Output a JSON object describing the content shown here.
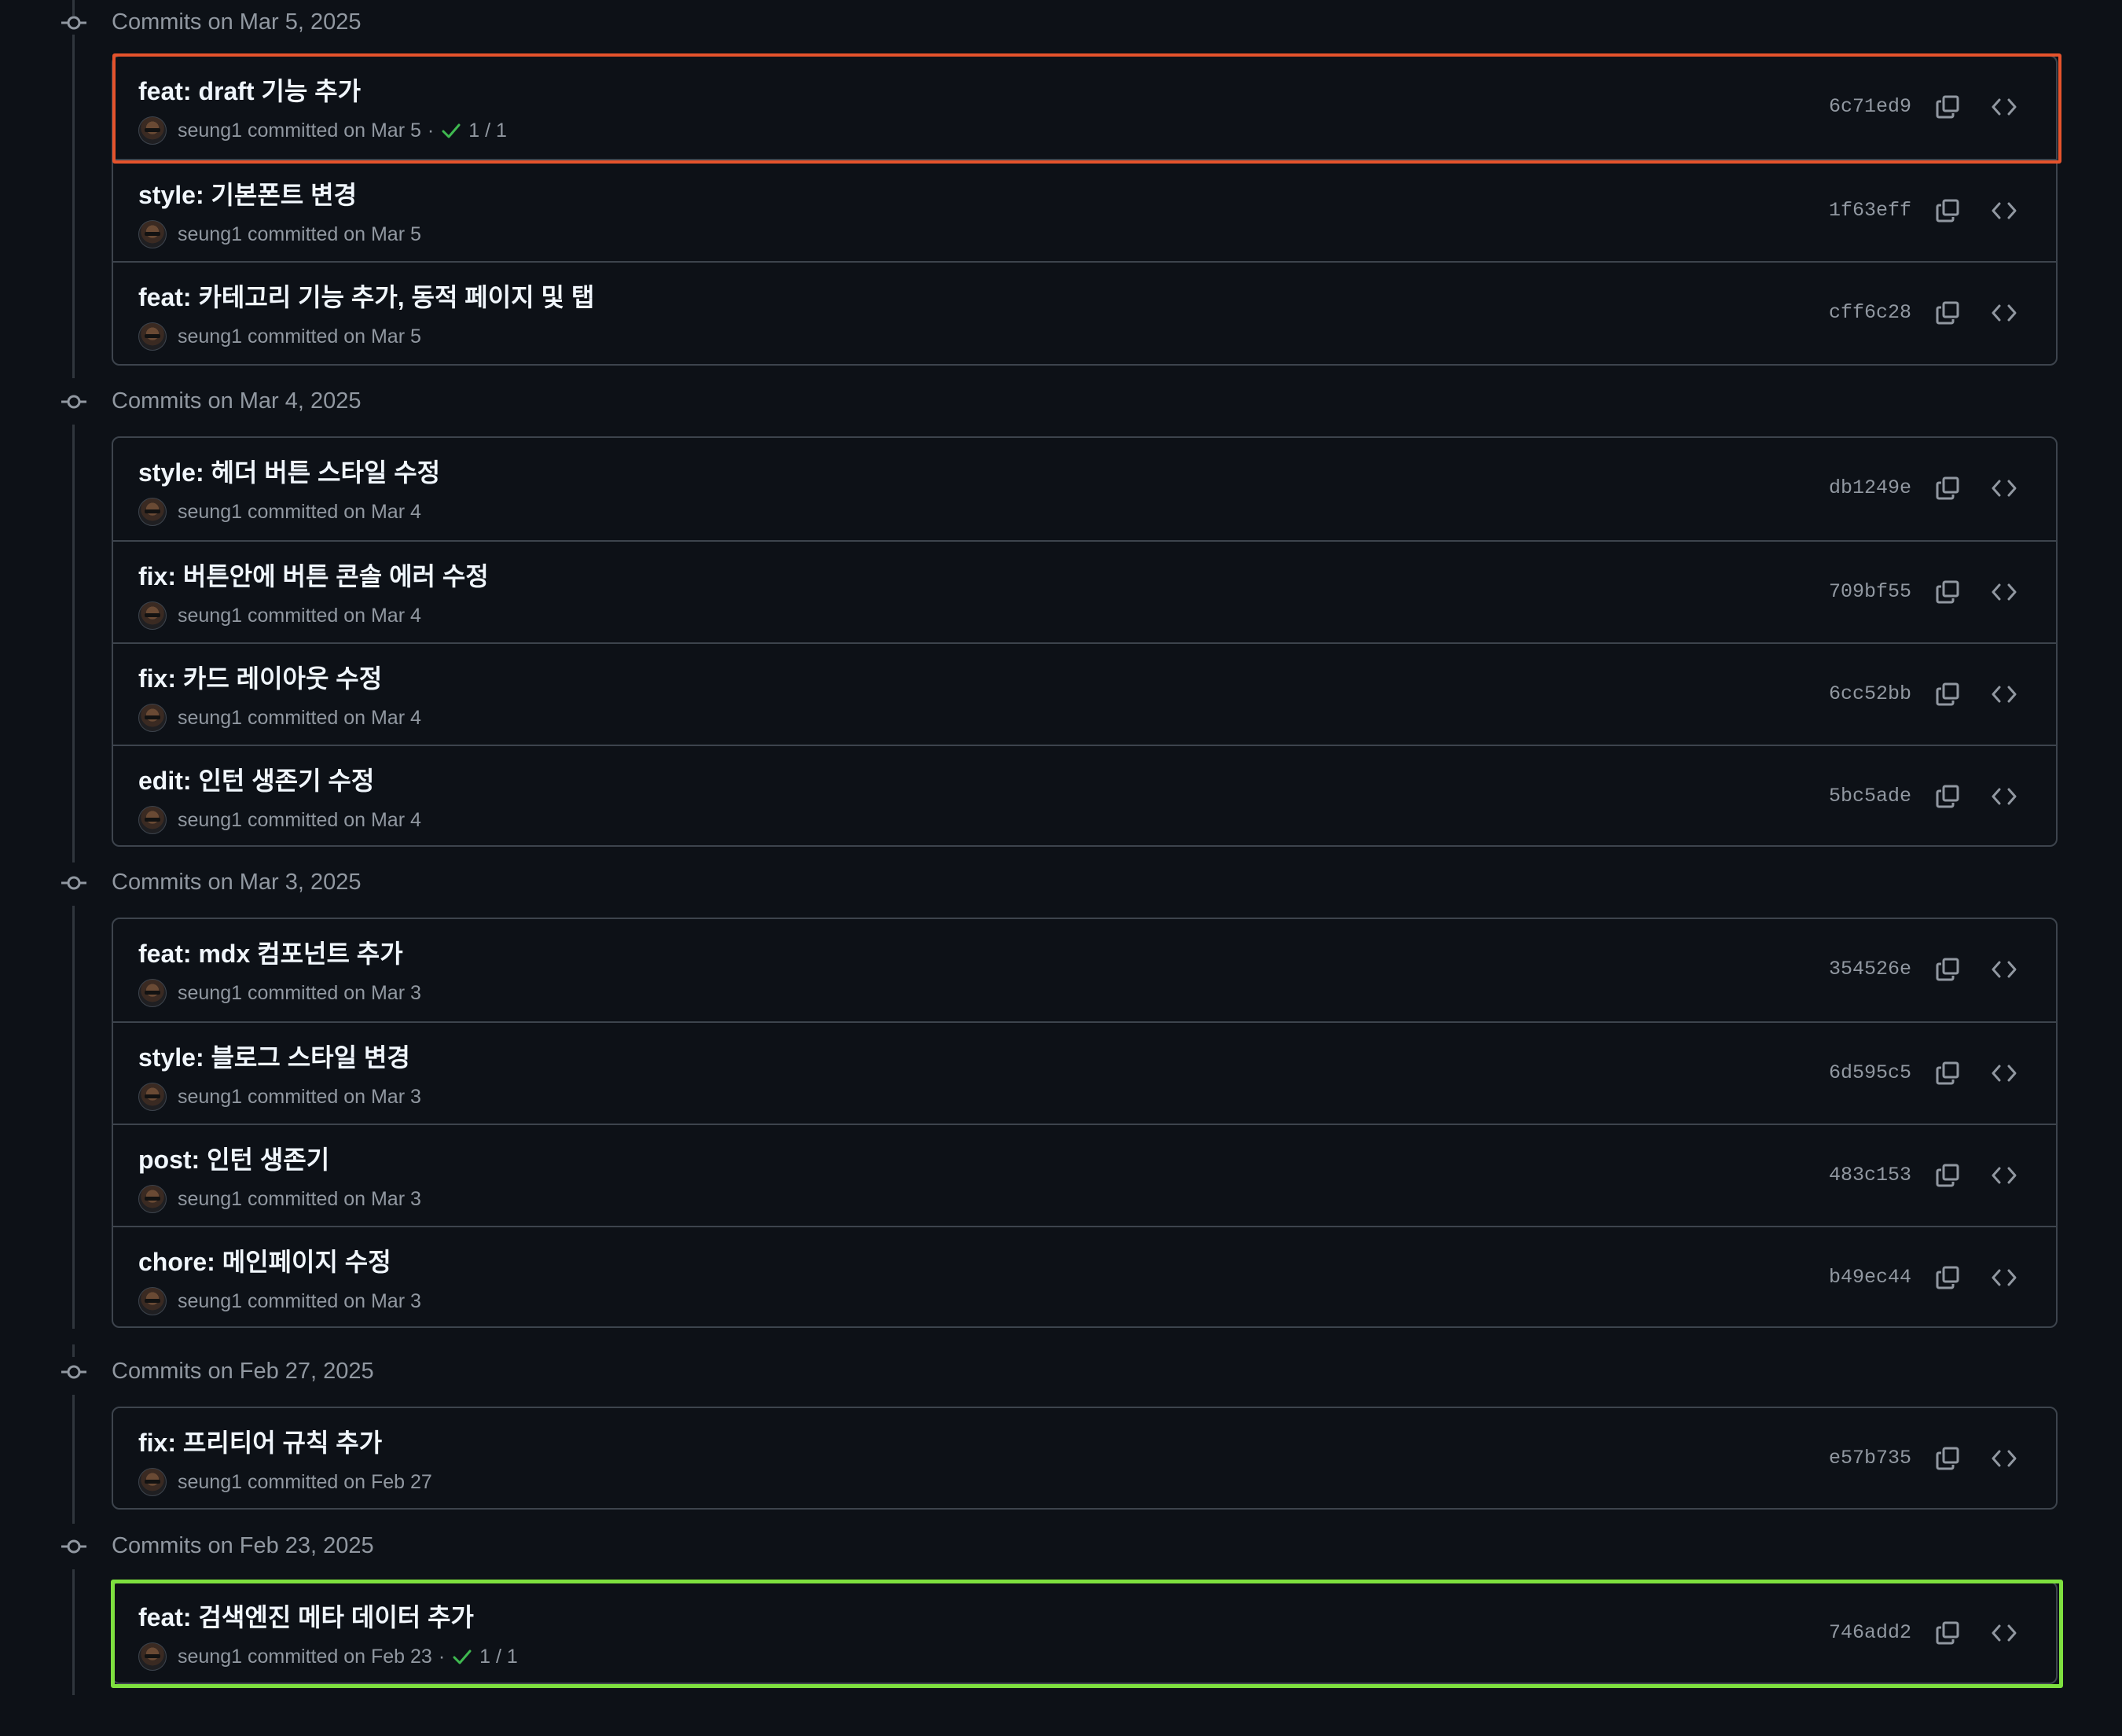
{
  "groups": [
    {
      "title": "Commits on Mar 5, 2025",
      "commits": [
        {
          "message": "feat: draft 기능 추가",
          "meta": "seung1 committed on Mar 5",
          "checks": "1 / 1",
          "sha": "6c71ed9"
        },
        {
          "message": "style: 기본폰트 변경",
          "meta": "seung1 committed on Mar 5",
          "checks": "",
          "sha": "1f63eff"
        },
        {
          "message": "feat: 카테고리 기능 추가, 동적 페이지 및 탭",
          "meta": "seung1 committed on Mar 5",
          "checks": "",
          "sha": "cff6c28"
        }
      ]
    },
    {
      "title": "Commits on Mar 4, 2025",
      "commits": [
        {
          "message": "style: 헤더 버튼 스타일 수정",
          "meta": "seung1 committed on Mar 4",
          "checks": "",
          "sha": "db1249e"
        },
        {
          "message": "fix: 버튼안에 버튼 콘솔 에러 수정",
          "meta": "seung1 committed on Mar 4",
          "checks": "",
          "sha": "709bf55"
        },
        {
          "message": "fix: 카드 레이아웃 수정",
          "meta": "seung1 committed on Mar 4",
          "checks": "",
          "sha": "6cc52bb"
        },
        {
          "message": "edit: 인턴 생존기 수정",
          "meta": "seung1 committed on Mar 4",
          "checks": "",
          "sha": "5bc5ade"
        }
      ]
    },
    {
      "title": "Commits on Mar 3, 2025",
      "commits": [
        {
          "message": "feat: mdx 컴포넌트 추가",
          "meta": "seung1 committed on Mar 3",
          "checks": "",
          "sha": "354526e"
        },
        {
          "message": "style: 블로그 스타일 변경",
          "meta": "seung1 committed on Mar 3",
          "checks": "",
          "sha": "6d595c5"
        },
        {
          "message": "post: 인턴 생존기",
          "meta": "seung1 committed on Mar 3",
          "checks": "",
          "sha": "483c153"
        },
        {
          "message": "chore: 메인페이지 수정",
          "meta": "seung1 committed on Mar 3",
          "checks": "",
          "sha": "b49ec44"
        }
      ]
    },
    {
      "title": "Commits on Feb 27, 2025",
      "commits": [
        {
          "message": "fix: 프리티어 규칙 추가",
          "meta": "seung1 committed on Feb 27",
          "checks": "",
          "sha": "e57b735"
        }
      ]
    },
    {
      "title": "Commits on Feb 23, 2025",
      "commits": [
        {
          "message": "feat: 검색엔진 메타 데이터 추가",
          "meta": "seung1 committed on Feb 23",
          "checks": "1 / 1",
          "sha": "746add2"
        }
      ]
    }
  ],
  "icons": {
    "group": "git-commit-icon",
    "copy": "copy-icon",
    "browse": "code-icon",
    "check": "check-icon"
  },
  "colors": {
    "background": "#0d1117",
    "border": "#3d444d",
    "muted_text": "#9198a1",
    "title_text": "#f0f6fc",
    "success": "#3fb950",
    "highlight_orange": "#e5532c",
    "highlight_green": "#7ee03f"
  }
}
